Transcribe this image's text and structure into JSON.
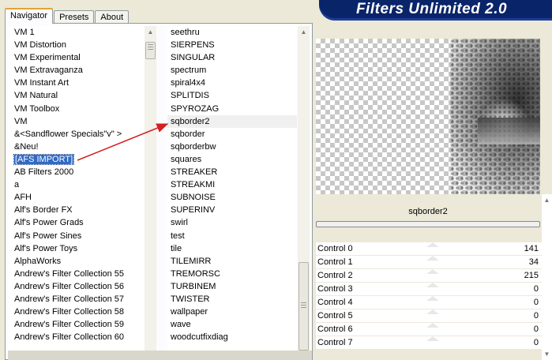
{
  "header": {
    "title": "Filters Unlimited 2.0"
  },
  "tabs": [
    "Navigator",
    "Presets",
    "About"
  ],
  "categories": [
    "VM 1",
    "VM Distortion",
    "VM Experimental",
    "VM Extravaganza",
    "VM Instant Art",
    "VM Natural",
    "VM Toolbox",
    "VM",
    "&<Sandflower Specials\"v\" >",
    "&Neu!",
    "[AFS IMPORT]",
    "AB Filters 2000",
    "a",
    "AFH",
    "Alf's Border FX",
    "Alf's Power Grads",
    "Alf's Power Sines",
    "Alf's Power Toys",
    "AlphaWorks",
    "Andrew's Filter Collection 55",
    "Andrew's Filter Collection 56",
    "Andrew's Filter Collection 57",
    "Andrew's Filter Collection 58",
    "Andrew's Filter Collection 59",
    "Andrew's Filter Collection 60"
  ],
  "selected_category": "[AFS IMPORT]",
  "filters": [
    "seethru",
    "SIERPENS",
    "SINGULAR",
    "spectrum",
    "spiral4x4",
    "SPLITDIS",
    "SPYROZAG",
    "sqborder2",
    "sqborder",
    "sqborderbw",
    "squares",
    "STREAKER",
    "STREAKMI",
    "SUBNOISE",
    "SUPERINV",
    "swirl",
    "test",
    "tile",
    "TILEMIRR",
    "TREMORSC",
    "TURBINEM",
    "TWISTER",
    "wallpaper",
    "wave",
    "woodcutfixdiag"
  ],
  "selected_filter": "sqborder2",
  "preview": {
    "filter_name": "sqborder2"
  },
  "controls": [
    {
      "label": "Control 0",
      "value": "141"
    },
    {
      "label": "Control 1",
      "value": "34"
    },
    {
      "label": "Control 2",
      "value": "215"
    },
    {
      "label": "Control 3",
      "value": "0"
    },
    {
      "label": "Control 4",
      "value": "0"
    },
    {
      "label": "Control 5",
      "value": "0"
    },
    {
      "label": "Control 6",
      "value": "0"
    },
    {
      "label": "Control 7",
      "value": "0"
    }
  ],
  "colors": {
    "selection": "#316ac5",
    "arrow": "#d32020",
    "banner": "#0a246a"
  }
}
